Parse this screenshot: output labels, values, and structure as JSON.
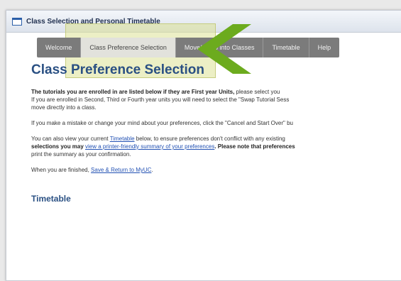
{
  "window": {
    "title": "Class Selection and Personal Timetable"
  },
  "tabs": [
    {
      "label": "Welcome"
    },
    {
      "label": "Class Preference Selection"
    },
    {
      "label": "Move/Swap into Classes"
    },
    {
      "label": "Timetable"
    },
    {
      "label": "Help"
    }
  ],
  "active_tab_index": 1,
  "highlight_color": "#dde296",
  "arrow_color": "#6cab1e",
  "page": {
    "title": "Class Preference Selection",
    "p1": {
      "line1_bold": "The tutorials you are enrolled in are listed below if they are First year Units,",
      "line1_rest": " please select you",
      "line2_pre": "If you are enrolled in Second, Third or Fourth year units you will need to select the \"Swap Tutorial Sess",
      "line3": "move directly into a class."
    },
    "p2": "If you make a mistake or change your mind about your preferences, click the \"Cancel and Start Over\" bu",
    "p3": {
      "line1_pre": "You can also view your current ",
      "line1_link": "Timetable",
      "line1_post": " below, to ensure preferences don't conflict with any existing",
      "line2_pre_bold": "selections you may ",
      "line2_link": "view a printer-friendly summary of your preferences",
      "line2_post_bold": ". Please note that preferences",
      "line3": "print the summary as your confirmation."
    },
    "p4_pre": "When you are finished, ",
    "p4_link": "Save & Return to MyUC",
    "p4_post": ".",
    "section_title": "Timetable"
  }
}
